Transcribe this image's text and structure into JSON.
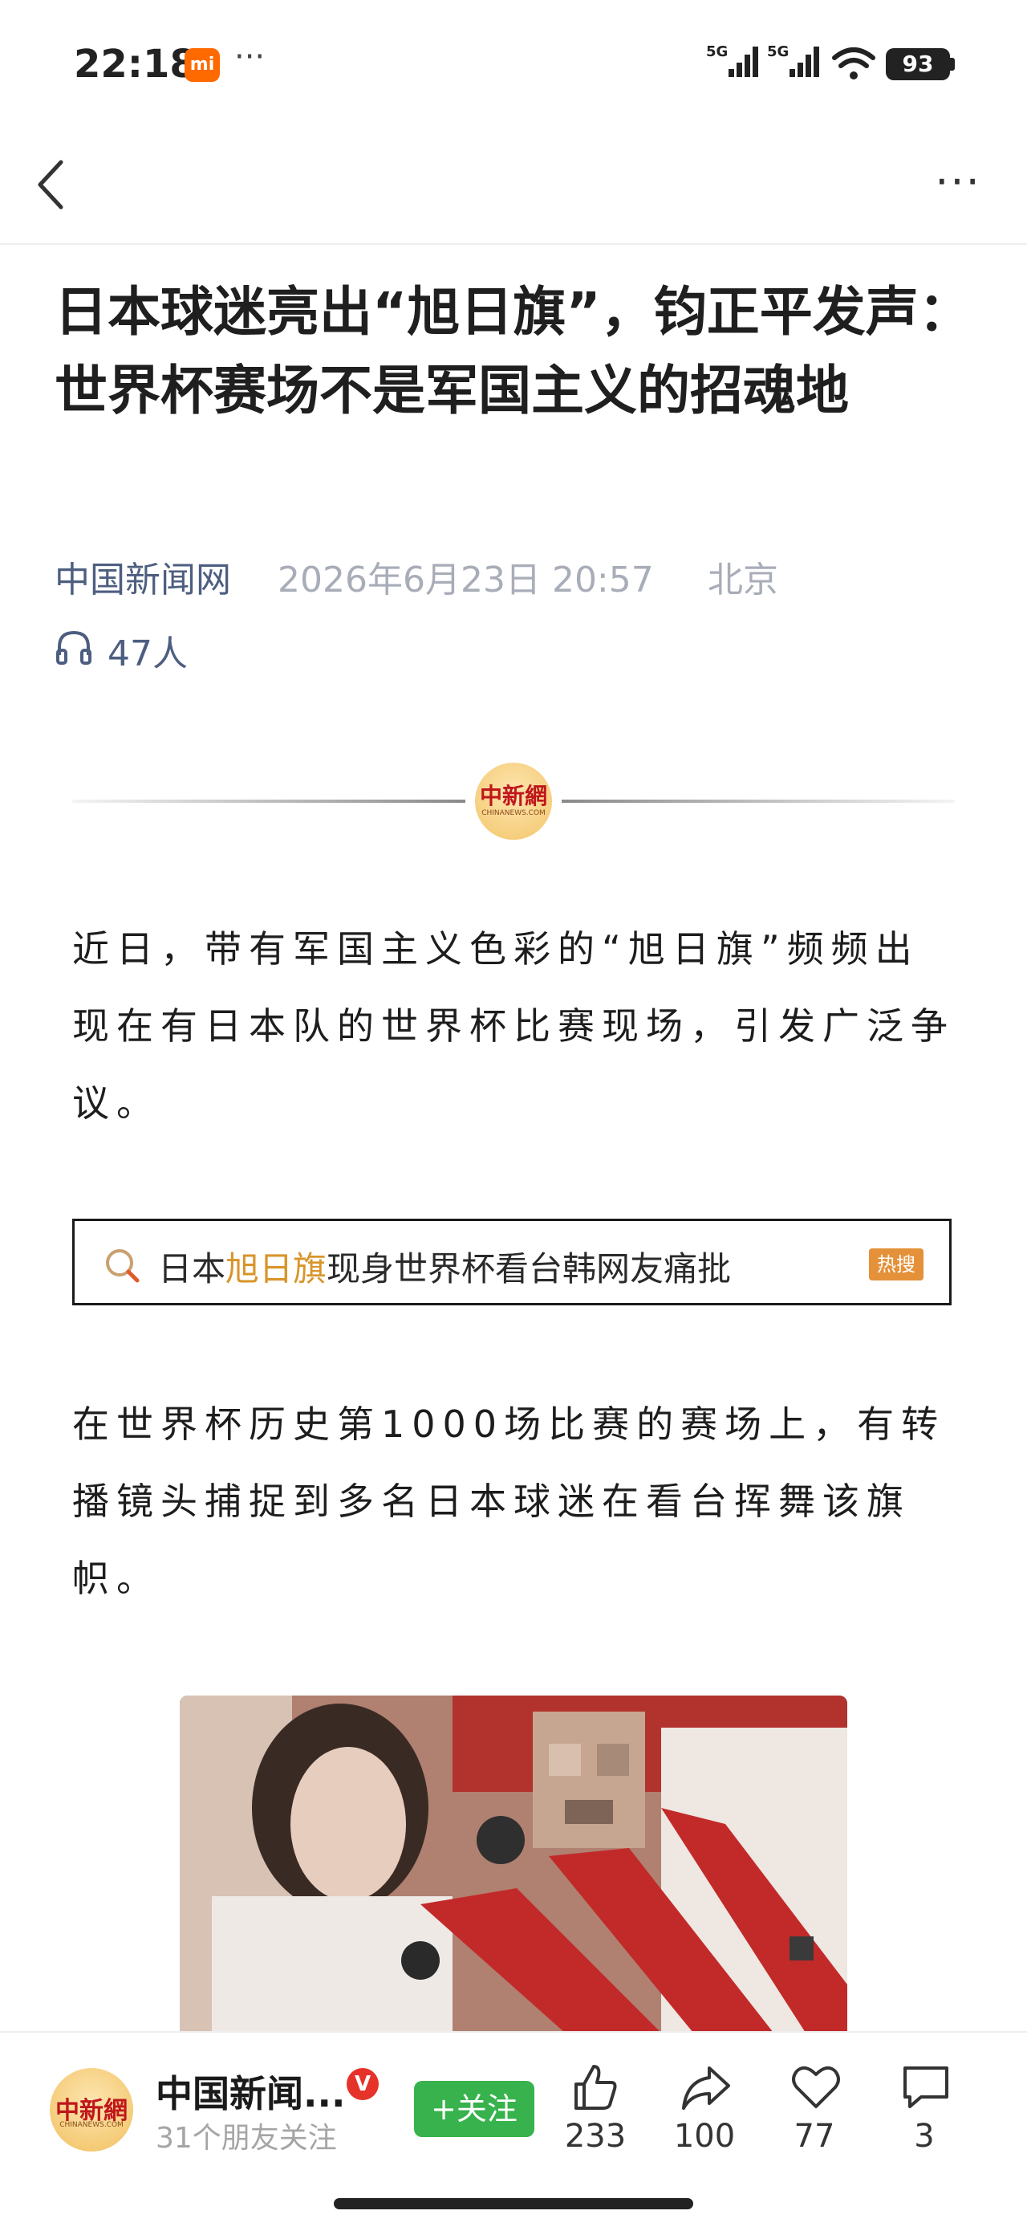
{
  "status_bar": {
    "time": "22:18",
    "app_badge": "mi",
    "more_dots": "···",
    "signal_1_label": "5G",
    "signal_2_label": "5G",
    "battery": "93"
  },
  "nav": {
    "back_icon": "chevron-left-icon",
    "more_icon": "more-horizontal-icon",
    "more_glyph": "···"
  },
  "article": {
    "title": "日本球迷亮出“旭日旗”，钧正平发声：世界杯赛场不是军国主义的招魂地",
    "source": "中国新闻网",
    "datetime": "2026年6月23日 20:57",
    "location": "北京",
    "listeners": "47人",
    "divider_logo": "中新網",
    "divider_logo_sub": "CHINANEWS.COM",
    "paragraph_1": "近日，带有军国主义色彩的“旭日旗”频频出现在有日本队的世界杯比赛现场，引发广泛争议。",
    "hot_search": {
      "prefix": "日本",
      "highlight": "旭日旗",
      "suffix": "现身世界杯看台韩网友痛批",
      "badge": "热搜",
      "highlight_color": "#d9942a"
    },
    "paragraph_2": "在世界杯历史第1000场比赛的赛场上，有转播镜头捕捉到多名日本球迷在看台挥舞该旗帜。"
  },
  "bottom_bar": {
    "avatar_logo": "中新網",
    "avatar_logo_sub": "CHINANEWS.COM",
    "author_name": "中国新闻...",
    "verified_badge": "V",
    "followers": "31个朋友关注",
    "follow_button": "+关注",
    "like_count": "233",
    "share_count": "100",
    "favorite_count": "77",
    "comment_count": "3",
    "follow_color": "#37b24d"
  }
}
